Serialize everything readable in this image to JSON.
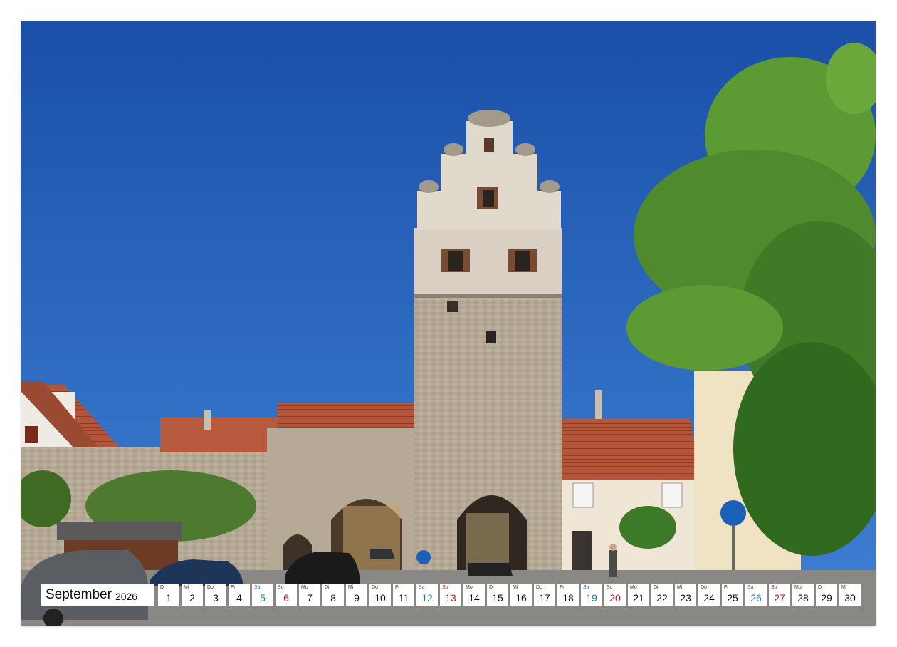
{
  "calendar": {
    "month": "September",
    "year": "2026",
    "days": [
      {
        "wd": "Di",
        "n": "1",
        "t": ""
      },
      {
        "wd": "Mi",
        "n": "2",
        "t": ""
      },
      {
        "wd": "Do",
        "n": "3",
        "t": ""
      },
      {
        "wd": "Fr",
        "n": "4",
        "t": ""
      },
      {
        "wd": "Sa",
        "n": "5",
        "t": "sat"
      },
      {
        "wd": "So",
        "n": "6",
        "t": "sun"
      },
      {
        "wd": "Mo",
        "n": "7",
        "t": ""
      },
      {
        "wd": "Di",
        "n": "8",
        "t": ""
      },
      {
        "wd": "Mi",
        "n": "9",
        "t": ""
      },
      {
        "wd": "Do",
        "n": "10",
        "t": ""
      },
      {
        "wd": "Fr",
        "n": "11",
        "t": ""
      },
      {
        "wd": "Sa",
        "n": "12",
        "t": "sat"
      },
      {
        "wd": "So",
        "n": "13",
        "t": "sun"
      },
      {
        "wd": "Mo",
        "n": "14",
        "t": ""
      },
      {
        "wd": "Di",
        "n": "15",
        "t": ""
      },
      {
        "wd": "Mi",
        "n": "16",
        "t": ""
      },
      {
        "wd": "Do",
        "n": "17",
        "t": ""
      },
      {
        "wd": "Fr",
        "n": "18",
        "t": ""
      },
      {
        "wd": "Sa",
        "n": "19",
        "t": "sat"
      },
      {
        "wd": "So",
        "n": "20",
        "t": "sun"
      },
      {
        "wd": "Mo",
        "n": "21",
        "t": ""
      },
      {
        "wd": "Di",
        "n": "22",
        "t": ""
      },
      {
        "wd": "Mi",
        "n": "23",
        "t": ""
      },
      {
        "wd": "Do",
        "n": "24",
        "t": ""
      },
      {
        "wd": "Fr",
        "n": "25",
        "t": ""
      },
      {
        "wd": "Sa",
        "n": "26",
        "t": "sat"
      },
      {
        "wd": "So",
        "n": "27",
        "t": "sun"
      },
      {
        "wd": "Mo",
        "n": "28",
        "t": ""
      },
      {
        "wd": "Di",
        "n": "29",
        "t": ""
      },
      {
        "wd": "Mi",
        "n": "30",
        "t": ""
      }
    ]
  },
  "colors": {
    "sky": "#1f5bb4",
    "stone": "#b7aa97",
    "roof": "#b4553a",
    "foliage": "#4f8a2e",
    "saturday": "#1a7fa8",
    "sunday": "#c8102e"
  }
}
